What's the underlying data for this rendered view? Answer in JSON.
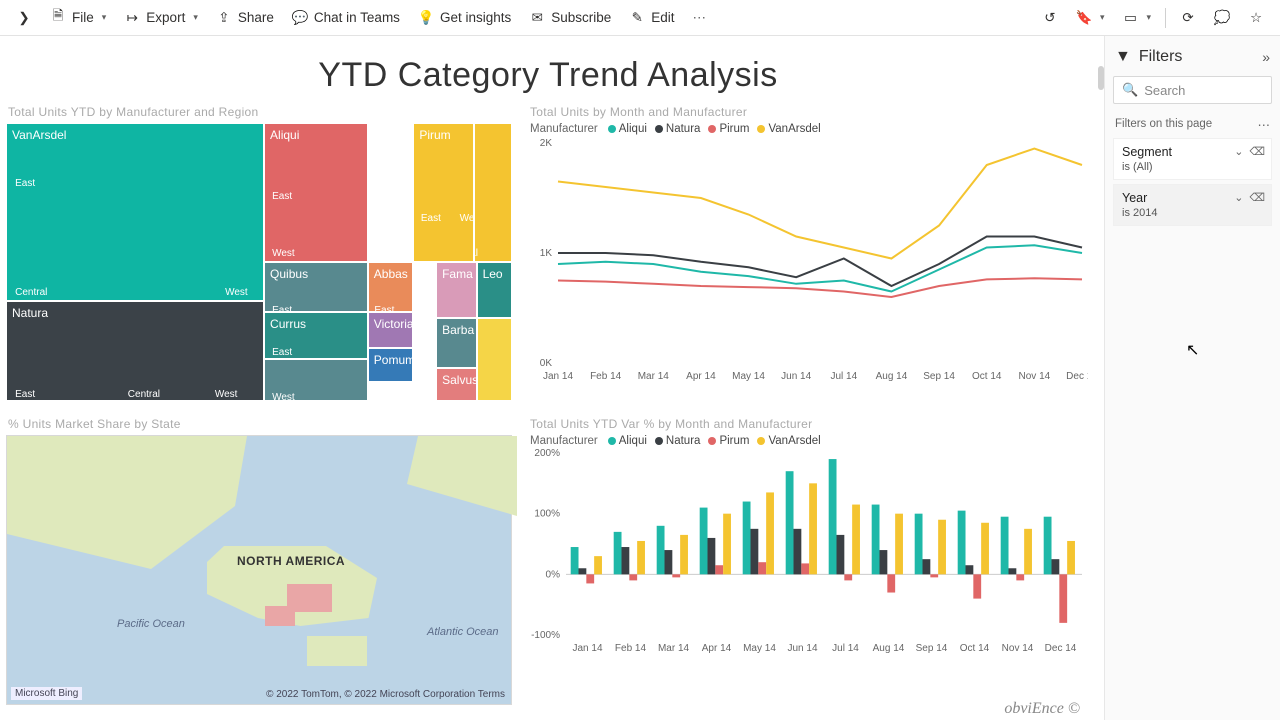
{
  "toolbar": {
    "file": "File",
    "export": "Export",
    "share": "Share",
    "chat": "Chat in Teams",
    "insights": "Get insights",
    "subscribe": "Subscribe",
    "edit": "Edit"
  },
  "filters": {
    "header": "Filters",
    "search_placeholder": "Search",
    "section": "Filters on this page",
    "cards": [
      {
        "name": "Segment",
        "value": "is (All)"
      },
      {
        "name": "Year",
        "value": "is 2014"
      }
    ]
  },
  "report": {
    "title": "YTD Category Trend Analysis",
    "tiles": {
      "treemap": {
        "title": "Total Units YTD by Manufacturer and Region",
        "items": [
          "VanArsdel",
          "Natura",
          "Aliqui",
          "Quibus",
          "Currus",
          "Abbas",
          "Victoria",
          "Pomum",
          "Pirum",
          "Fama",
          "Barba",
          "Salvus",
          "Leo"
        ],
        "regions": [
          "East",
          "Central",
          "West"
        ]
      },
      "line": {
        "title": "Total Units by Month and Manufacturer",
        "legend_title": "Manufacturer",
        "series_names": [
          "Aliqui",
          "Natura",
          "Pirum",
          "VanArsdel"
        ]
      },
      "map": {
        "title": "% Units Market Share by State",
        "na": "NORTH AMERICA",
        "pacific": "Pacific Ocean",
        "atlantic": "Atlantic Ocean",
        "bing": "Microsoft Bing",
        "copy": "© 2022 TomTom, © 2022 Microsoft Corporation    Terms"
      },
      "bar": {
        "title": "Total Units YTD Var % by Month and Manufacturer",
        "legend_title": "Manufacturer",
        "series_names": [
          "Aliqui",
          "Natura",
          "Pirum",
          "VanArsdel"
        ]
      }
    },
    "months": [
      "Jan 14",
      "Feb 14",
      "Mar 14",
      "Apr 14",
      "May 14",
      "Jun 14",
      "Jul 14",
      "Aug 14",
      "Sep 14",
      "Oct 14",
      "Nov 14",
      "Dec 14"
    ],
    "footer_brand": "obviEnce ©"
  },
  "colors": {
    "Aliqui": "#1fb8a8",
    "Natura": "#3a3f44",
    "Pirum": "#e06666",
    "VanArsdel": "#f4c430"
  },
  "chart_data": [
    {
      "id": "line",
      "type": "line",
      "title": "Total Units by Month and Manufacturer",
      "xlabel": "",
      "ylabel": "",
      "categories": [
        "Jan 14",
        "Feb 14",
        "Mar 14",
        "Apr 14",
        "May 14",
        "Jun 14",
        "Jul 14",
        "Aug 14",
        "Sep 14",
        "Oct 14",
        "Nov 14",
        "Dec 14"
      ],
      "ylim": [
        0,
        2000
      ],
      "yticks": [
        0,
        1000,
        2000
      ],
      "series": [
        {
          "name": "VanArsdel",
          "color": "#f4c430",
          "values": [
            1650,
            1600,
            1550,
            1500,
            1350,
            1150,
            1050,
            950,
            1250,
            1800,
            1950,
            1800
          ]
        },
        {
          "name": "Natura",
          "color": "#3a3f44",
          "values": [
            1000,
            1000,
            980,
            920,
            870,
            780,
            950,
            700,
            900,
            1150,
            1150,
            1050
          ]
        },
        {
          "name": "Aliqui",
          "color": "#1fb8a8",
          "values": [
            900,
            920,
            900,
            830,
            790,
            720,
            750,
            650,
            850,
            1050,
            1070,
            1000
          ]
        },
        {
          "name": "Pirum",
          "color": "#e06666",
          "values": [
            750,
            740,
            720,
            700,
            690,
            680,
            650,
            600,
            700,
            760,
            770,
            760
          ]
        }
      ]
    },
    {
      "id": "bar",
      "type": "bar",
      "title": "Total Units YTD Var % by Month and Manufacturer",
      "categories": [
        "Jan 14",
        "Feb 14",
        "Mar 14",
        "Apr 14",
        "May 14",
        "Jun 14",
        "Jul 14",
        "Aug 14",
        "Sep 14",
        "Oct 14",
        "Nov 14",
        "Dec 14"
      ],
      "ylim": [
        -100,
        200
      ],
      "yticks": [
        -100,
        0,
        100,
        200
      ],
      "series": [
        {
          "name": "Aliqui",
          "color": "#1fb8a8",
          "values": [
            45,
            70,
            80,
            110,
            120,
            170,
            190,
            115,
            100,
            105,
            95,
            95
          ]
        },
        {
          "name": "Natura",
          "color": "#3a3f44",
          "values": [
            10,
            45,
            40,
            60,
            75,
            75,
            65,
            40,
            25,
            15,
            10,
            25
          ]
        },
        {
          "name": "Pirum",
          "color": "#e06666",
          "values": [
            -15,
            -10,
            -5,
            15,
            20,
            18,
            -10,
            -30,
            -5,
            -40,
            -10,
            -80
          ]
        },
        {
          "name": "VanArsdel",
          "color": "#f4c430",
          "values": [
            30,
            55,
            65,
            100,
            135,
            150,
            115,
            100,
            90,
            85,
            75,
            55
          ]
        }
      ]
    },
    {
      "id": "treemap",
      "type": "treemap",
      "title": "Total Units YTD by Manufacturer and Region",
      "series": [
        {
          "name": "VanArsdel",
          "children": [
            {
              "name": "East",
              "value": 38
            },
            {
              "name": "Central",
              "value": 19
            },
            {
              "name": "West",
              "value": 10
            }
          ]
        },
        {
          "name": "Natura",
          "children": [
            {
              "name": "East",
              "value": 14
            },
            {
              "name": "Central",
              "value": 9
            },
            {
              "name": "West",
              "value": 7
            }
          ]
        },
        {
          "name": "Aliqui",
          "children": [
            {
              "name": "East",
              "value": 10
            },
            {
              "name": "West",
              "value": 7
            },
            {
              "name": "Central",
              "value": 4
            }
          ]
        },
        {
          "name": "Quibus",
          "children": [
            {
              "name": "East",
              "value": 6
            }
          ]
        },
        {
          "name": "Currus",
          "children": [
            {
              "name": "East",
              "value": 4
            },
            {
              "name": "West",
              "value": 2
            }
          ]
        },
        {
          "name": "Abbas",
          "children": [
            {
              "name": "East",
              "value": 5
            }
          ]
        },
        {
          "name": "Victoria",
          "children": [
            {
              "name": "East",
              "value": 4
            }
          ]
        },
        {
          "name": "Pomum",
          "children": [
            {
              "name": "East",
              "value": 3
            }
          ]
        },
        {
          "name": "Pirum",
          "children": [
            {
              "name": "East",
              "value": 7
            },
            {
              "name": "West",
              "value": 4
            },
            {
              "name": "Central",
              "value": 3
            }
          ]
        },
        {
          "name": "Fama",
          "children": [
            {
              "name": "East",
              "value": 3
            }
          ]
        },
        {
          "name": "Barba",
          "children": [
            {
              "name": "East",
              "value": 3
            }
          ]
        },
        {
          "name": "Salvus",
          "children": [
            {
              "name": "East",
              "value": 2
            }
          ]
        },
        {
          "name": "Leo",
          "children": [
            {
              "name": "East",
              "value": 2
            }
          ]
        }
      ]
    }
  ]
}
